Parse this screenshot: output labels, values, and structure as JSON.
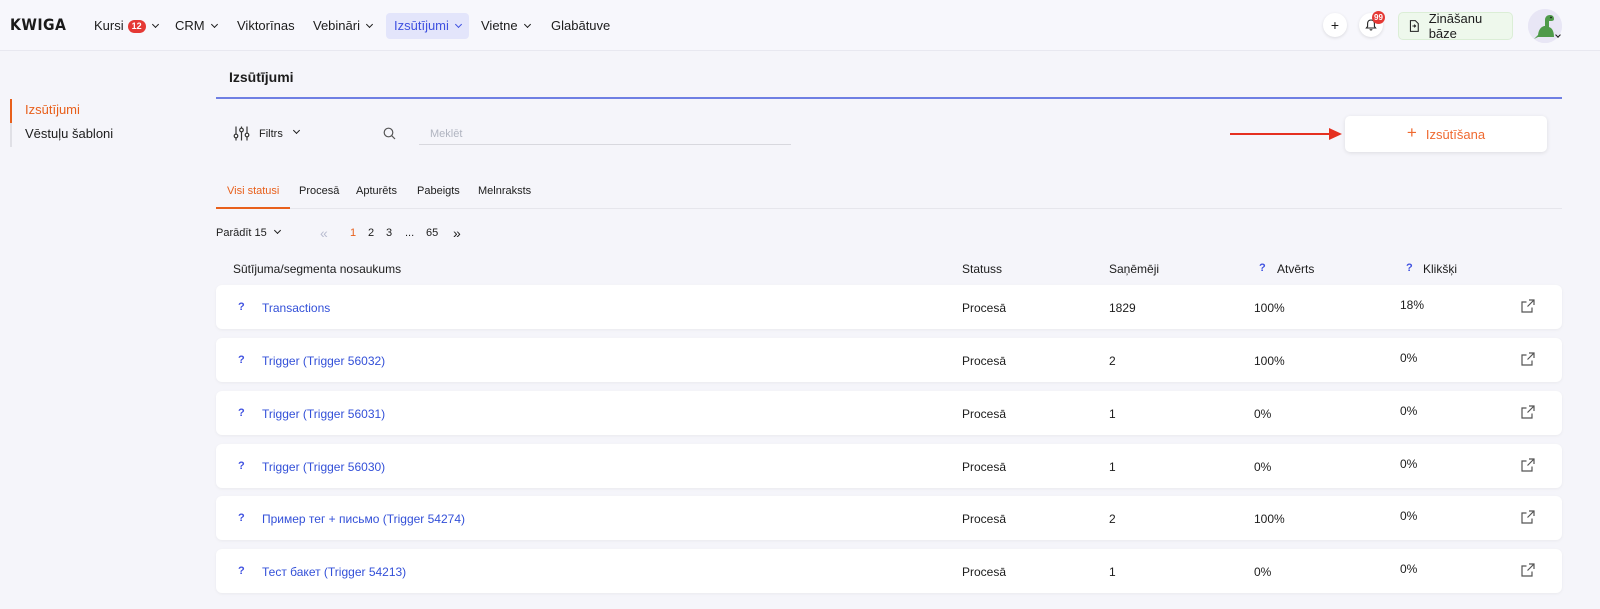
{
  "nav": {
    "logo": "KWIGA",
    "items": [
      {
        "label": "Kursi",
        "badge": "12"
      },
      {
        "label": "CRM"
      },
      {
        "label": "Viktorīnas"
      },
      {
        "label": "Vebināri"
      },
      {
        "label": "Izsūtījumi"
      },
      {
        "label": "Vietne"
      },
      {
        "label": "Glabātuve"
      }
    ],
    "notif_count": "99",
    "knowledge_base": "Zināšanu bāze",
    "accent": "#3f51e0"
  },
  "sidebar": {
    "items": [
      {
        "label": "Izsūtījumi"
      },
      {
        "label": "Vēstuļu šabloni"
      }
    ]
  },
  "page": {
    "title": "Izsūtījumi",
    "filter_label": "Filtrs",
    "search_placeholder": "Meklēt",
    "send_button": "Izsūtīšana",
    "accent": "#e8601c"
  },
  "tabs": [
    "Visi statusi",
    "Procesā",
    "Apturēts",
    "Pabeigts",
    "Melnraksts"
  ],
  "pagination": {
    "show_label": "Parādīt 15",
    "pages": [
      "1",
      "2",
      "3",
      "...",
      "65"
    ]
  },
  "table": {
    "headers": {
      "name": "Sūtījuma/segmenta nosaukums",
      "status": "Statuss",
      "recipients": "Saņēmēji",
      "opened": "Atvērts",
      "clicks": "Klikšķi",
      "help": "?"
    },
    "rows": [
      {
        "name": "Transactions",
        "status": "Procesā",
        "recipients": "1829",
        "opened": "100%",
        "clicks": "18%"
      },
      {
        "name": "Trigger (Trigger 56032)",
        "status": "Procesā",
        "recipients": "2",
        "opened": "100%",
        "clicks": "0%"
      },
      {
        "name": "Trigger (Trigger 56031)",
        "status": "Procesā",
        "recipients": "1",
        "opened": "0%",
        "clicks": "0%"
      },
      {
        "name": "Trigger (Trigger 56030)",
        "status": "Procesā",
        "recipients": "1",
        "opened": "0%",
        "clicks": "0%"
      },
      {
        "name": "Пример тег + письмо (Trigger 54274)",
        "status": "Procesā",
        "recipients": "2",
        "opened": "100%",
        "clicks": "0%"
      },
      {
        "name": "Тест бакет (Trigger 54213)",
        "status": "Procesā",
        "recipients": "1",
        "opened": "0%",
        "clicks": "0%"
      }
    ]
  }
}
